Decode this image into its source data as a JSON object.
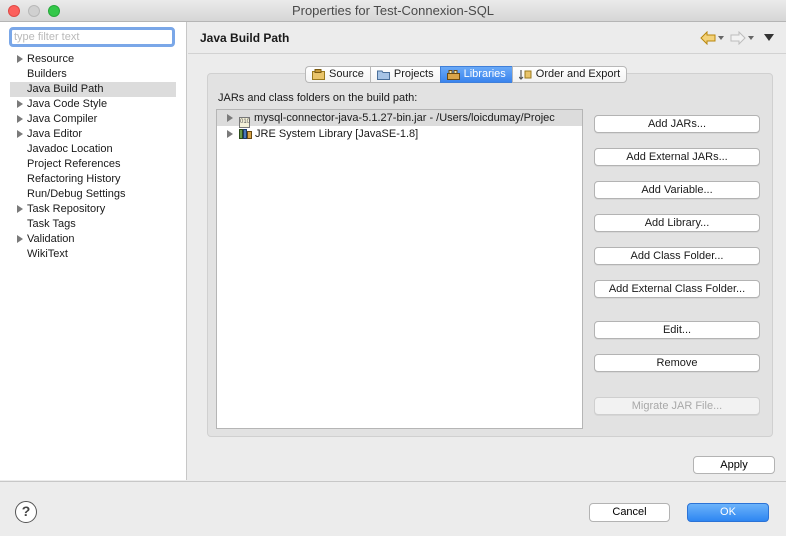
{
  "window": {
    "title": "Properties for Test-Connexion-SQL"
  },
  "filter": {
    "placeholder": "type filter text",
    "value": ""
  },
  "tree": [
    {
      "label": "Resource",
      "expandable": true
    },
    {
      "label": "Builders",
      "expandable": false
    },
    {
      "label": "Java Build Path",
      "expandable": false,
      "selected": true
    },
    {
      "label": "Java Code Style",
      "expandable": true
    },
    {
      "label": "Java Compiler",
      "expandable": true
    },
    {
      "label": "Java Editor",
      "expandable": true
    },
    {
      "label": "Javadoc Location",
      "expandable": false
    },
    {
      "label": "Project References",
      "expandable": false
    },
    {
      "label": "Refactoring History",
      "expandable": false
    },
    {
      "label": "Run/Debug Settings",
      "expandable": false
    },
    {
      "label": "Task Repository",
      "expandable": true
    },
    {
      "label": "Task Tags",
      "expandable": false
    },
    {
      "label": "Validation",
      "expandable": true
    },
    {
      "label": "WikiText",
      "expandable": false
    }
  ],
  "header": {
    "title": "Java Build Path"
  },
  "tabs": [
    {
      "label": "Source",
      "icon": "source-icon"
    },
    {
      "label": "Projects",
      "icon": "folder-icon"
    },
    {
      "label": "Libraries",
      "icon": "libraries-icon",
      "active": true
    },
    {
      "label": "Order and Export",
      "icon": "order-icon"
    }
  ],
  "libraries": {
    "list_label": "JARs and class folders on the build path:",
    "entries": [
      {
        "label": "mysql-connector-java-5.1.27-bin.jar - /Users/loicdumay/Projec",
        "icon": "jar-icon",
        "selected": true
      },
      {
        "label": "JRE System Library [JavaSE-1.8]",
        "icon": "library-icon",
        "selected": false
      }
    ]
  },
  "buttons": {
    "add_jars": "Add JARs...",
    "add_external_jars": "Add External JARs...",
    "add_variable": "Add Variable...",
    "add_library": "Add Library...",
    "add_class_folder": "Add Class Folder...",
    "add_external_class_folder": "Add External Class Folder...",
    "edit": "Edit...",
    "remove": "Remove",
    "migrate_jar": "Migrate JAR File...",
    "apply": "Apply",
    "cancel": "Cancel",
    "ok": "OK",
    "help": "?"
  },
  "colors": {
    "accent": "#3a84ee",
    "selection": "#dcdcdc"
  }
}
